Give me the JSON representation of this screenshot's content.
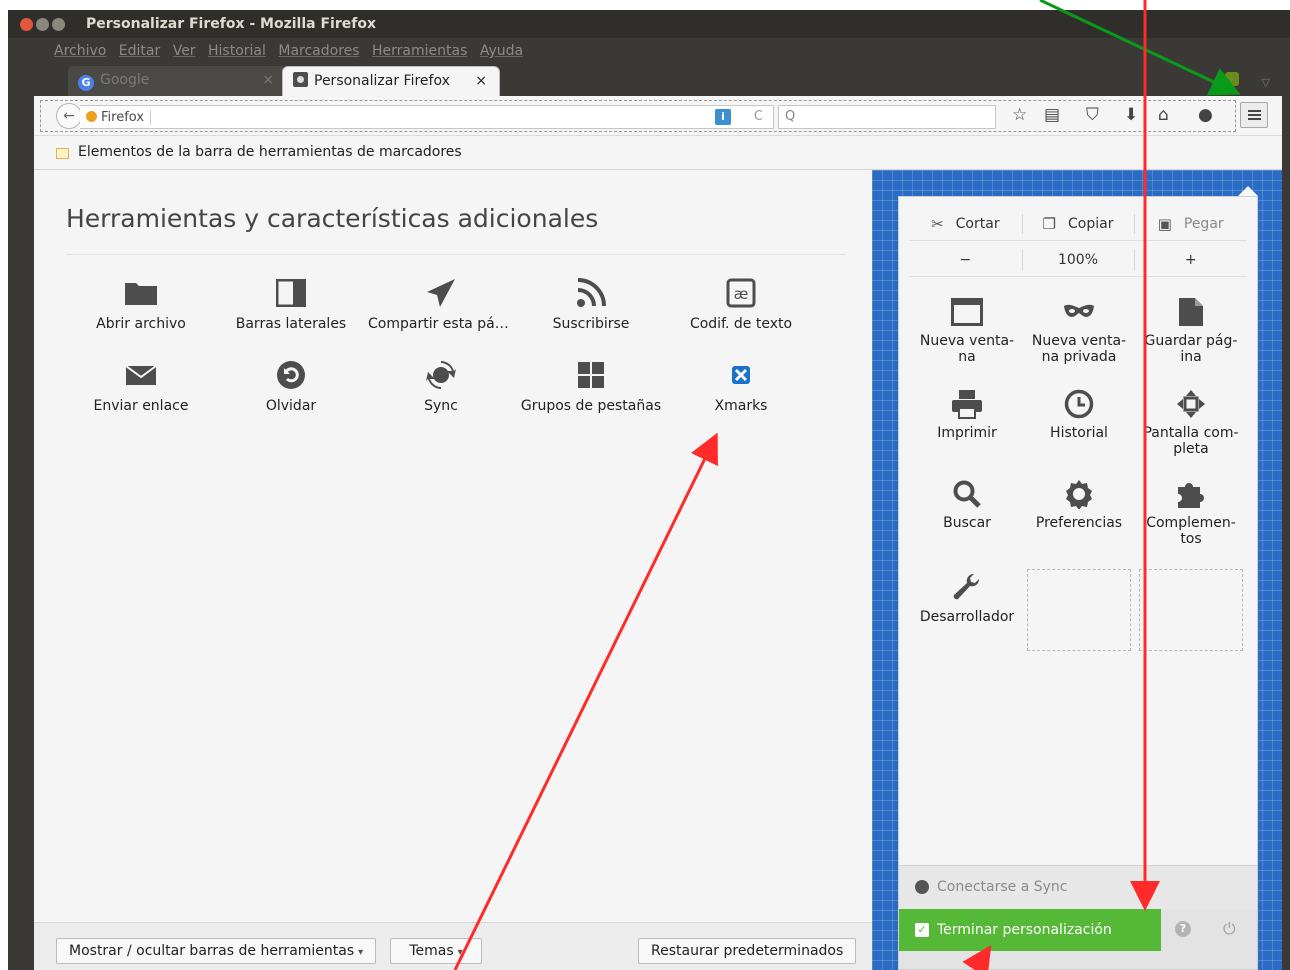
{
  "window": {
    "title": "Personalizar Firefox - Mozilla Firefox"
  },
  "menubar": {
    "items": [
      "Archivo",
      "Editar",
      "Ver",
      "Historial",
      "Marcadores",
      "Herramientas",
      "Ayuda"
    ]
  },
  "tabs": [
    {
      "label": "Google",
      "close": "×",
      "active": false
    },
    {
      "label": "Personalizar Firefox",
      "close": "×",
      "active": true
    }
  ],
  "navbar": {
    "identity_label": "Firefox",
    "info_badge": "i",
    "reload_glyph": "C",
    "search_glyph": "Q",
    "back_glyph": "←"
  },
  "bookmarks": {
    "label": "Elementos de la barra de herramientas de marcadores"
  },
  "palette": {
    "title": "Herramientas y características adicionales",
    "items": [
      {
        "label": "Abrir archivo",
        "icon": "folder-icon"
      },
      {
        "label": "Barras laterales",
        "icon": "sidebar-icon"
      },
      {
        "label": "Compartir esta pág...",
        "icon": "share-icon"
      },
      {
        "label": "Suscribirse",
        "icon": "rss-icon"
      },
      {
        "label": "Codif. de texto",
        "icon": "text-encoding-icon"
      },
      {
        "label": "Enviar enlace",
        "icon": "mail-icon"
      },
      {
        "label": "Olvidar",
        "icon": "forget-icon"
      },
      {
        "label": "Sync",
        "icon": "sync-icon"
      },
      {
        "label": "Grupos de pestañas",
        "icon": "tab-groups-icon"
      },
      {
        "label": "Xmarks",
        "icon": "xmarks-icon"
      }
    ]
  },
  "footer": {
    "toolbars_btn": "Mostrar / ocultar barras de herramientas",
    "themes_btn": "Temas",
    "restore_btn": "Restaurar predeterminados",
    "dropdown_glyph": "▾"
  },
  "panel": {
    "edit": {
      "cut": "Cortar",
      "copy": "Copiar",
      "paste": "Pegar"
    },
    "zoom": {
      "minus": "−",
      "level": "100%",
      "plus": "+"
    },
    "items": [
      {
        "label": "Nueva venta-\nna",
        "icon": "new-window-icon"
      },
      {
        "label": "Nueva venta-\nna privada",
        "icon": "private-window-icon"
      },
      {
        "label": "Guardar pág-\nina",
        "icon": "save-page-icon"
      },
      {
        "label": "Imprimir",
        "icon": "print-icon"
      },
      {
        "label": "Historial",
        "icon": "history-icon"
      },
      {
        "label": "Pantalla com-\npleta",
        "icon": "fullscreen-icon"
      },
      {
        "label": "Buscar",
        "icon": "search-icon"
      },
      {
        "label": "Preferencias",
        "icon": "preferences-icon"
      },
      {
        "label": "Complemen-\ntos",
        "icon": "addons-icon"
      },
      {
        "label": "Desarrollador",
        "icon": "developer-icon"
      }
    ],
    "sync_label": "Conectarse a Sync",
    "finish_label": "Terminar personalización",
    "help_glyph": "?",
    "check_glyph": "✓",
    "quit_glyph": "⏻"
  },
  "colors": {
    "accent_green": "#55b836",
    "panel_blue": "#2a6cc4",
    "arrow_red": "#ff2a2a",
    "arrow_green": "#0a9a1a"
  }
}
